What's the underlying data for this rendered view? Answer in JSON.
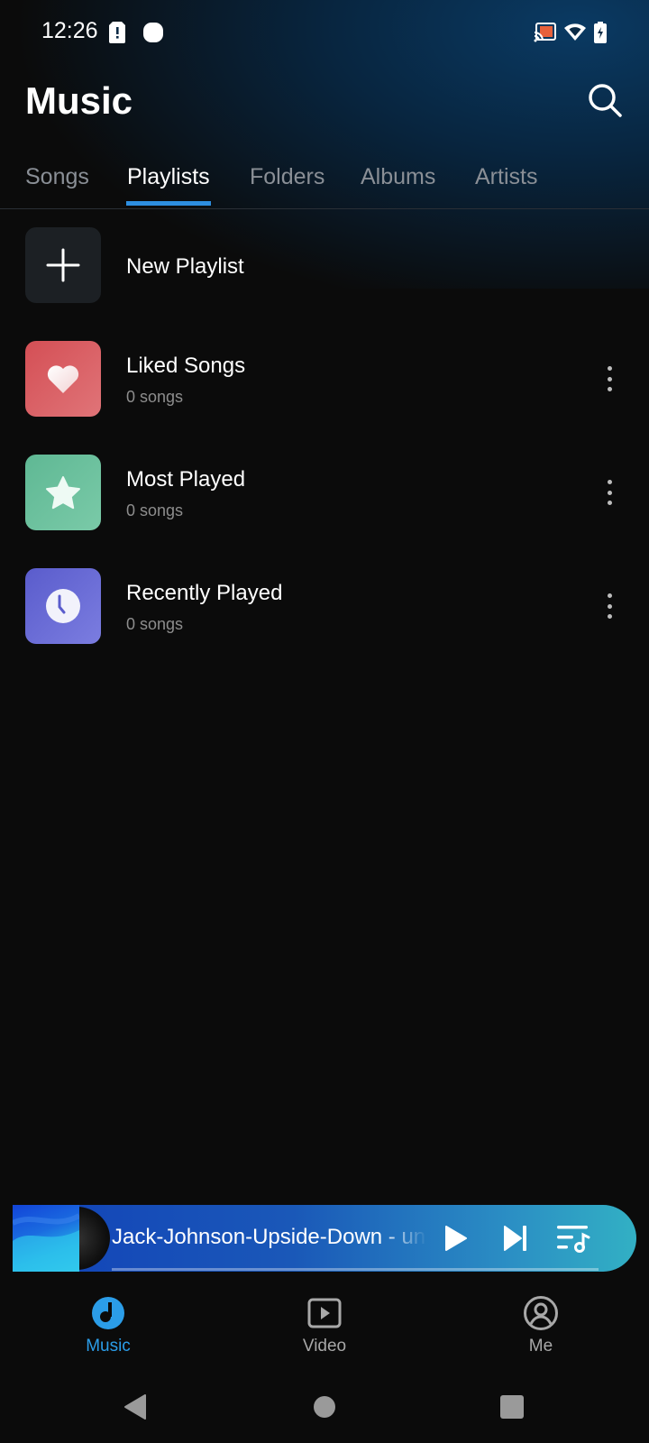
{
  "status_bar": {
    "time": "12:26",
    "left_icons": [
      "sim-alert-icon",
      "notification-dot-icon"
    ],
    "right_icons": [
      "cast-icon",
      "wifi-icon",
      "battery-charging-icon"
    ]
  },
  "header": {
    "title": "Music",
    "search_icon": "search-icon"
  },
  "tabs": [
    {
      "label": "Songs",
      "active": false
    },
    {
      "label": "Playlists",
      "active": true
    },
    {
      "label": "Folders",
      "active": false
    },
    {
      "label": "Albums",
      "active": false
    },
    {
      "label": "Artists",
      "active": false
    }
  ],
  "playlists": {
    "new_playlist": {
      "label": "New Playlist",
      "icon": "plus-icon"
    },
    "items": [
      {
        "title": "Liked Songs",
        "count": "0 songs",
        "icon": "heart-icon",
        "color": "#d9595f"
      },
      {
        "title": "Most Played",
        "count": "0 songs",
        "icon": "star-icon",
        "color": "#6dc3a0"
      },
      {
        "title": "Recently Played",
        "count": "0 songs",
        "icon": "clock-icon",
        "color": "#6a6ad6"
      }
    ]
  },
  "mini_player": {
    "title": "Jack-Johnson-Upside-Down - unknown",
    "progress": 0,
    "buttons": [
      "play-icon",
      "skip-next-icon",
      "queue-icon"
    ]
  },
  "bottom_nav": [
    {
      "label": "Music",
      "icon": "music-icon",
      "active": true
    },
    {
      "label": "Video",
      "icon": "video-icon",
      "active": false
    },
    {
      "label": "Me",
      "icon": "profile-icon",
      "active": false
    }
  ],
  "colors": {
    "accent": "#2d8ee0",
    "background": "#0b0b0b"
  }
}
